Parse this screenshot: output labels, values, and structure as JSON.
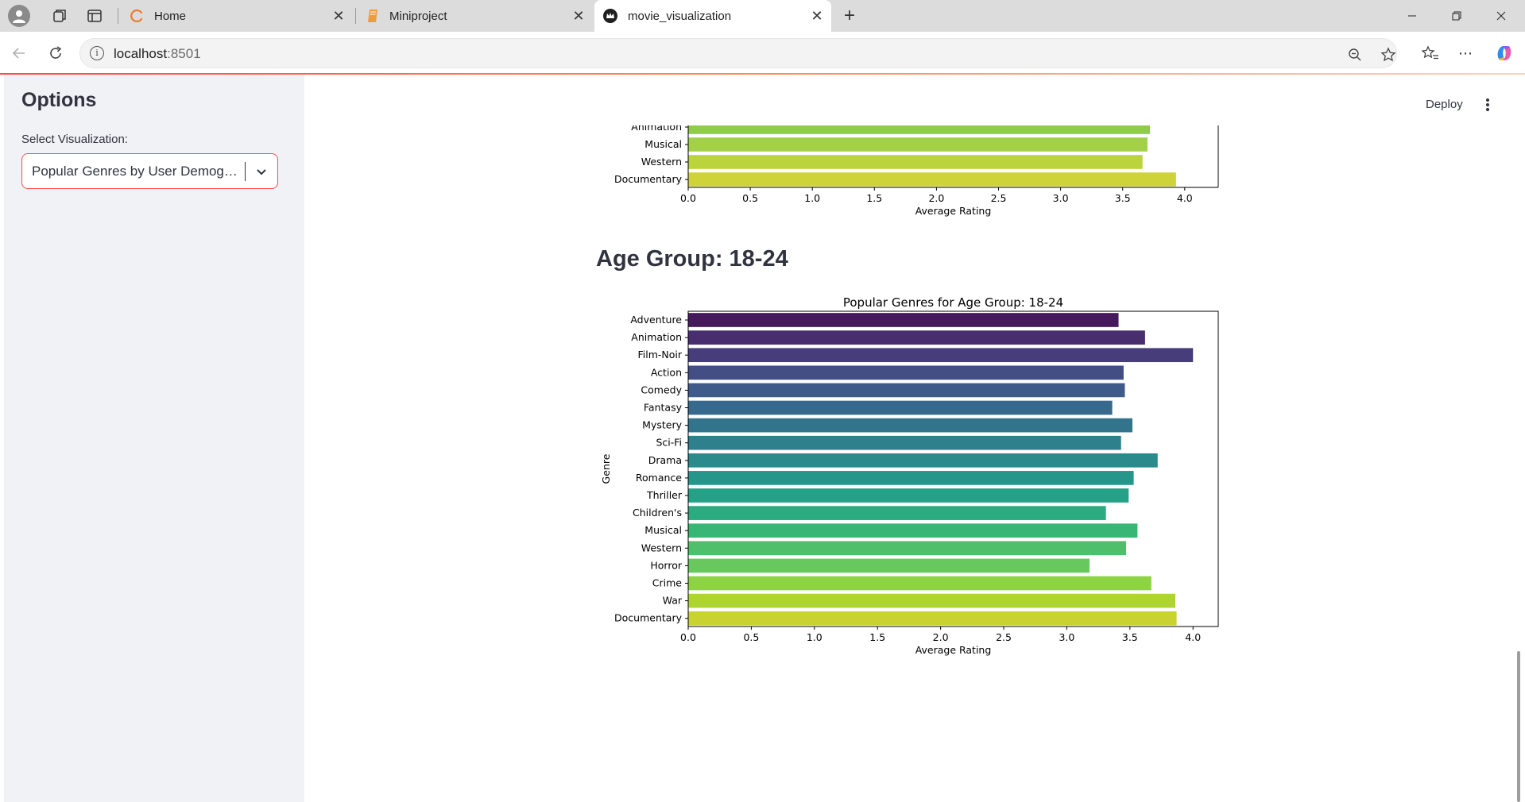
{
  "browser": {
    "tabs": [
      {
        "title": "Home",
        "icon": "loading-spinner-icon"
      },
      {
        "title": "Miniproject",
        "icon": "notebook-icon"
      },
      {
        "title": "movie_visualization",
        "icon": "streamlit-crown-icon"
      }
    ],
    "url_host": "localhost",
    "url_port": ":8501"
  },
  "sidebar": {
    "title": "Options",
    "select_label": "Select Visualization:",
    "select_value": "Popular Genres by User Demographics"
  },
  "header": {
    "deploy_label": "Deploy"
  },
  "main": {
    "section_heading": "Age Group: 18-24"
  },
  "chart_data": [
    {
      "type": "bar",
      "orientation": "horizontal",
      "partially_visible": true,
      "categories": [
        "Animation",
        "Musical",
        "Western",
        "Documentary"
      ],
      "values": [
        3.72,
        3.7,
        3.66,
        3.93
      ],
      "xlabel": "Average Rating",
      "xticks": [
        "0.0",
        "0.5",
        "1.0",
        "1.5",
        "2.0",
        "2.5",
        "3.0",
        "3.5",
        "4.0"
      ],
      "xlim": [
        0,
        4.27
      ],
      "colors": [
        "#8fcb4d",
        "#a2d147",
        "#bcd43b",
        "#cfd33a"
      ]
    },
    {
      "type": "bar",
      "orientation": "horizontal",
      "title": "Popular Genres for Age Group: 18-24",
      "xlabel": "Average Rating",
      "ylabel": "Genre",
      "categories": [
        "Adventure",
        "Animation",
        "Film-Noir",
        "Action",
        "Comedy",
        "Fantasy",
        "Mystery",
        "Sci-Fi",
        "Drama",
        "Romance",
        "Thriller",
        "Children's",
        "Musical",
        "Western",
        "Horror",
        "Crime",
        "War",
        "Documentary"
      ],
      "values": [
        3.41,
        3.62,
        4.0,
        3.45,
        3.46,
        3.36,
        3.52,
        3.43,
        3.72,
        3.53,
        3.49,
        3.31,
        3.56,
        3.47,
        3.18,
        3.67,
        3.86,
        3.87
      ],
      "xticks": [
        "0.0",
        "0.5",
        "1.0",
        "1.5",
        "2.0",
        "2.5",
        "3.0",
        "3.5",
        "4.0"
      ],
      "xlim": [
        0,
        4.2
      ],
      "colors": [
        "#46195d",
        "#482e6f",
        "#473d7a",
        "#434e84",
        "#3e5b8a",
        "#37698c",
        "#33748d",
        "#2e808d",
        "#2a8a8c",
        "#26968a",
        "#24a187",
        "#2aab80",
        "#37b676",
        "#4ec06b",
        "#68c85d",
        "#8ed245",
        "#aed52f",
        "#c8d332"
      ],
      "grid": false,
      "legend": "none"
    }
  ]
}
